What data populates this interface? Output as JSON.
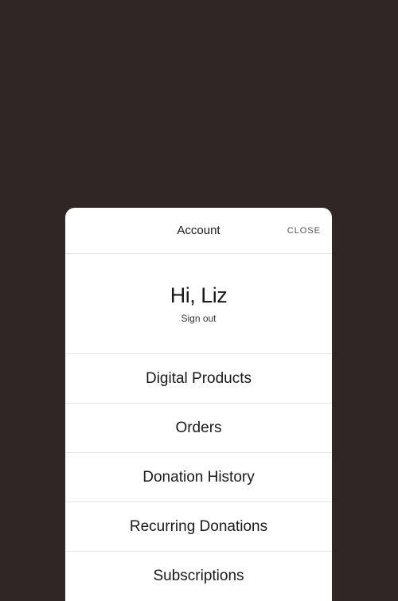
{
  "panel": {
    "title": "Account",
    "close_label": "CLOSE",
    "greeting": "Hi, Liz",
    "signout_label": "Sign out",
    "menu": [
      {
        "label": "Digital Products"
      },
      {
        "label": "Orders"
      },
      {
        "label": "Donation History"
      },
      {
        "label": "Recurring Donations"
      },
      {
        "label": "Subscriptions"
      }
    ]
  }
}
